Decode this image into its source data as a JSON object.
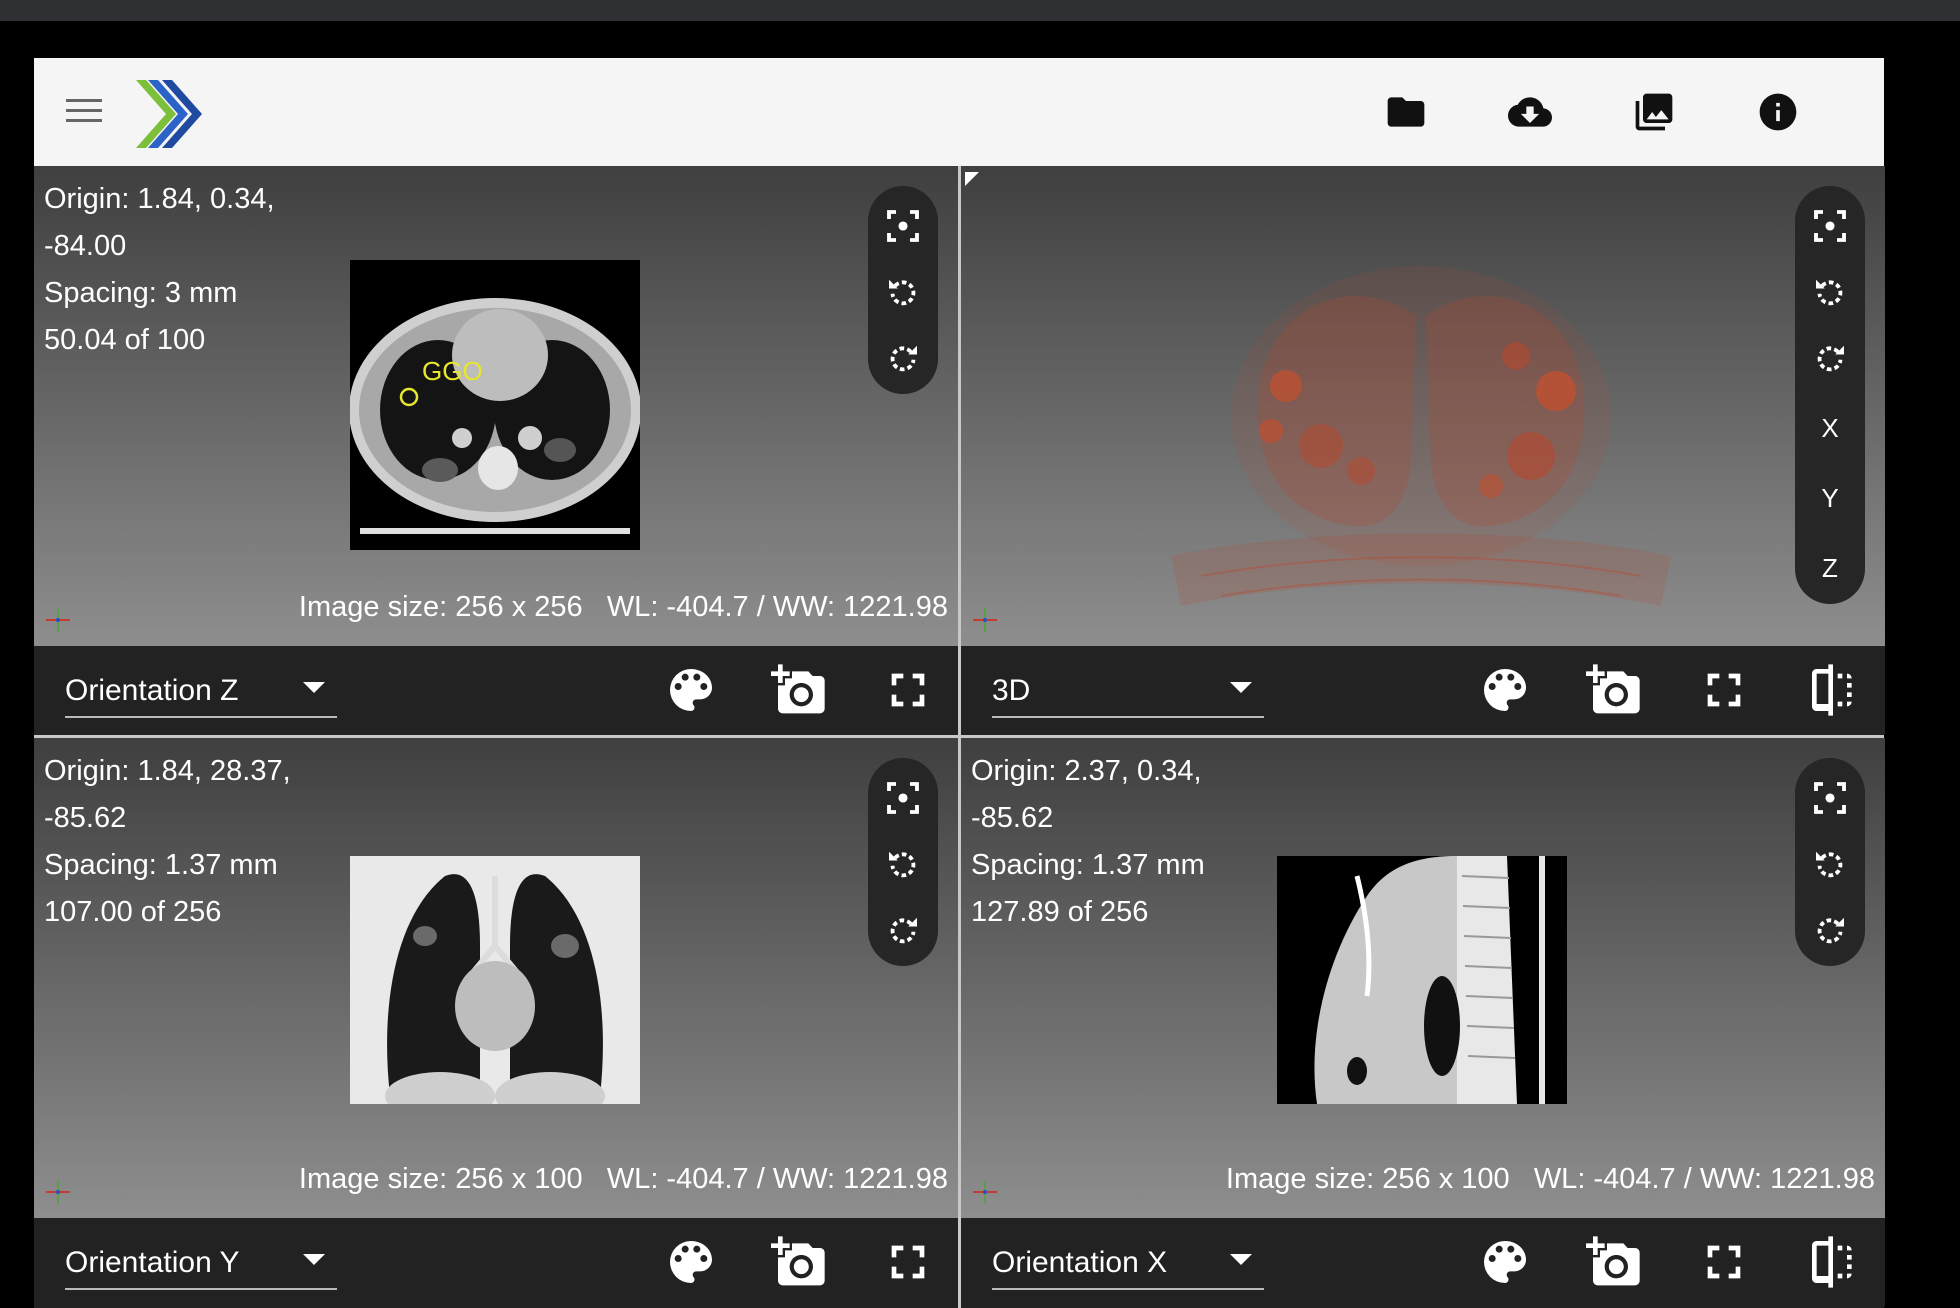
{
  "app": {
    "toolbar_icons": [
      "folder-icon",
      "cloud-download-icon",
      "images-icon",
      "info-icon"
    ]
  },
  "views": {
    "z": {
      "origin_line1": "Origin: 1.84, 0.34,",
      "origin_line2": "-84.00",
      "spacing": "Spacing: 3 mm",
      "slice": "50.04 of 100",
      "image_size": "Image size: 256 x 256",
      "window": "WL: -404.7 / WW: 1221.98",
      "annotation": "GGO",
      "orientation": "Orientation Z"
    },
    "three_d": {
      "orientation": "3D",
      "axis_buttons": [
        "X",
        "Y",
        "Z"
      ]
    },
    "y": {
      "origin_line1": "Origin: 1.84, 28.37,",
      "origin_line2": "-85.62",
      "spacing": "Spacing: 1.37 mm",
      "slice": "107.00 of 256",
      "image_size": "Image size: 256 x 100",
      "window": "WL: -404.7 / WW: 1221.98",
      "orientation": "Orientation Y"
    },
    "x": {
      "origin_line1": "Origin: 2.37, 0.34,",
      "origin_line2": "-85.62",
      "spacing": "Spacing: 1.37 mm",
      "slice": "127.89 of 256",
      "image_size": "Image size: 256 x 100",
      "window": "WL: -404.7 / WW: 1221.98",
      "orientation": "Orientation X"
    }
  },
  "colors": {
    "annotation": "#e6e62a",
    "volume_render": "#b5482f",
    "accent_logo_blue": "#2b63c9",
    "accent_logo_green": "#7cbf3b"
  }
}
